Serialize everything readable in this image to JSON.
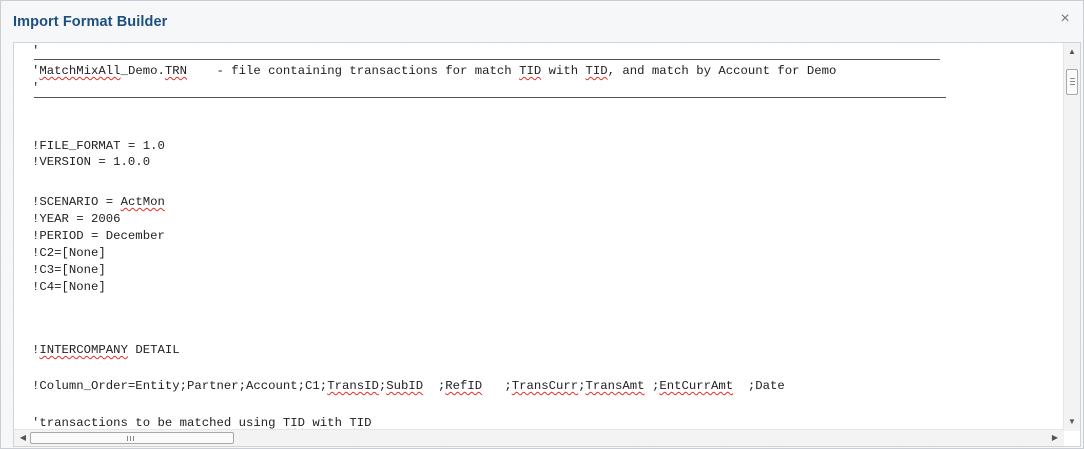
{
  "dialog": {
    "title": "Import Format Builder",
    "close_glyph": "×"
  },
  "editor": {
    "lines": [
      "'",
      "'MatchMixAll_Demo.TRN    - file containing transactions for match TID with TID, and match by Account for Demo",
      "'",
      "!FILE_FORMAT = 1.0",
      "!VERSION = 1.0.0",
      "!SCENARIO = ActMon",
      "!YEAR = 2006",
      "!PERIOD = December",
      "!C2=[None]",
      "!C3=[None]",
      "!C4=[None]",
      "!INTERCOMPANY DETAIL",
      "!Column_Order=Entity;Partner;Account;C1;TransID;SubID  ;RefID   ;TransCurr;TransAmt ;EntCurrAmt  ;Date",
      "'transactions to be matched using TID with TID"
    ],
    "spellcheck_flagged_words": [
      "MatchMixAll",
      "TRN",
      "TID",
      "ActMon",
      "INTERCOMPANY",
      "TransID",
      "SubID",
      "RefID",
      "TransCurr",
      "TransAmt",
      "EntCurrAmt"
    ]
  },
  "scrollbars": {
    "vertical": {
      "up_icon": "▲",
      "down_icon": "▼"
    },
    "horizontal": {
      "left_icon": "◀",
      "right_icon": "▶"
    }
  },
  "colors": {
    "title": "#1d4e80",
    "spellcheck_underline": "#e0302a"
  }
}
